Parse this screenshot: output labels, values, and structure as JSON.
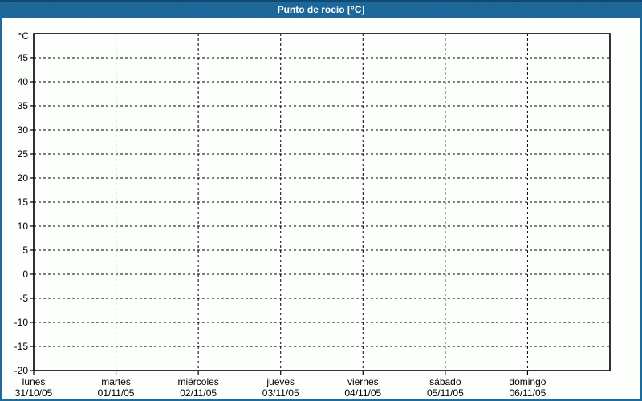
{
  "header": {
    "title": "Punto de rocío [°C]"
  },
  "colors": {
    "titlebar_bg": "#1d6a9d",
    "titlebar_top_edge": "#0f4a75",
    "titlebar_text": "#ffffff",
    "window_border": "#1d6a9d",
    "panel_bg": "#fdfffd",
    "axis_and_grid": "#000000"
  },
  "chart_data": {
    "type": "line",
    "title": "Punto de rocío [°C]",
    "xlabel": "",
    "ylabel": "°C",
    "ylim": [
      -20,
      50
    ],
    "y_tick_step": 5,
    "y_ticks": [
      45,
      40,
      35,
      30,
      25,
      20,
      15,
      10,
      5,
      0,
      -5,
      -10,
      -15,
      -20
    ],
    "grid": "dashed",
    "legend_position": "none",
    "x_categories": [
      {
        "day": "lunes",
        "date": "31/10/05"
      },
      {
        "day": "martes",
        "date": "01/11/05"
      },
      {
        "day": "miércoles",
        "date": "02/11/05"
      },
      {
        "day": "jueves",
        "date": "03/11/05"
      },
      {
        "day": "viernes",
        "date": "04/11/05"
      },
      {
        "day": "sábado",
        "date": "05/11/05"
      },
      {
        "day": "domingo",
        "date": "06/11/05"
      }
    ],
    "series": []
  }
}
